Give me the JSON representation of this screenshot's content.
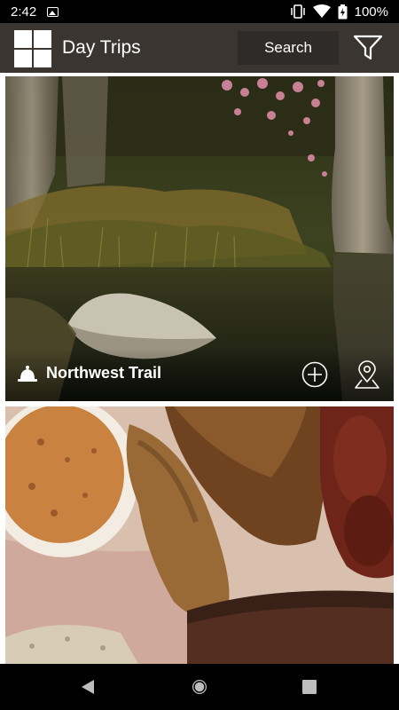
{
  "status_bar": {
    "time": "2:42",
    "battery": "100%"
  },
  "app_bar": {
    "title": "Day Trips",
    "search_label": "Search"
  },
  "cards": [
    {
      "title": "Northwest Trail",
      "icon": "bell-icon",
      "image": "nature-pond-trees"
    },
    {
      "title": "",
      "image": "bbq-platter"
    }
  ],
  "colors": {
    "app_bar_bg": "#3a3531",
    "search_bg": "#2f2b28",
    "status_bg": "#000000"
  }
}
